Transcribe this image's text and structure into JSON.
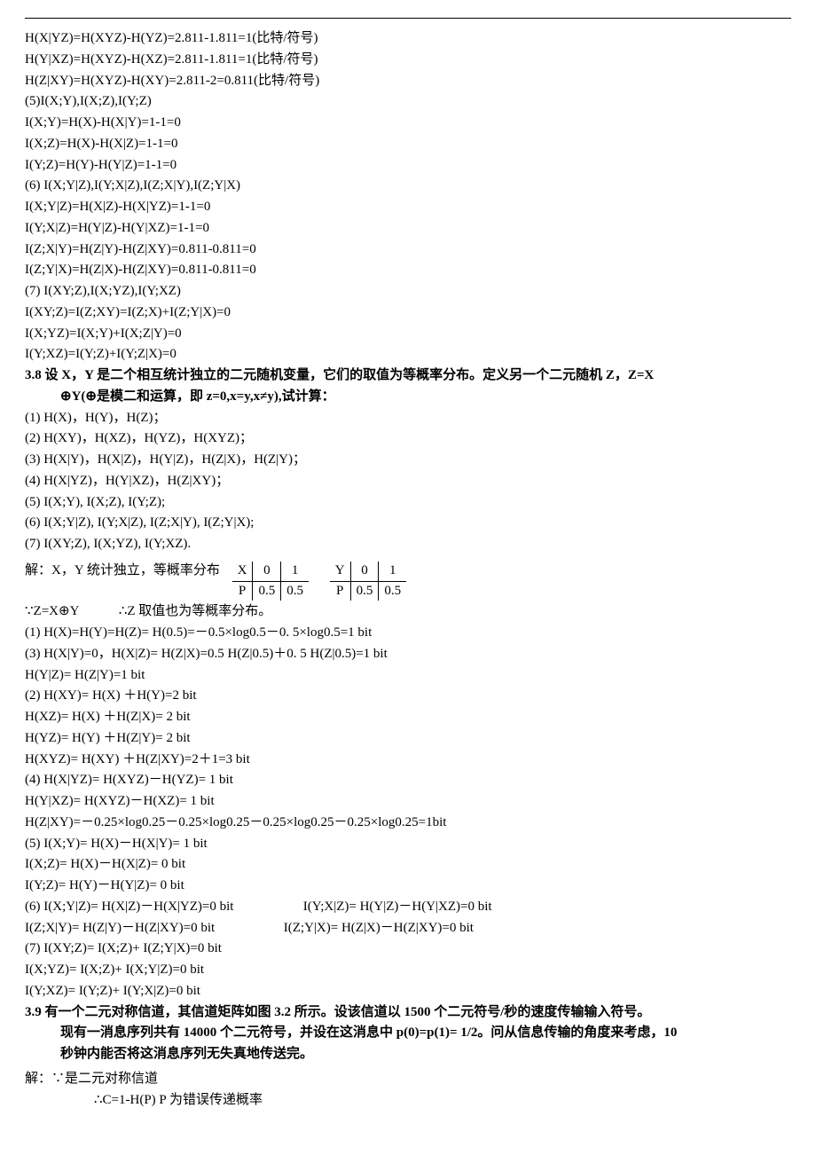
{
  "sec1": {
    "l1": "H(X|YZ)=H(XYZ)-H(YZ)=2.811-1.811=1(比特/符号)",
    "l2": "H(Y|XZ)=H(XYZ)-H(XZ)=2.811-1.811=1(比特/符号)",
    "l3": "H(Z|XY)=H(XYZ)-H(XY)=2.811-2=0.811(比特/符号)",
    "h5": "(5)I(X;Y),I(X;Z),I(Y;Z)",
    "l5a": "I(X;Y)=H(X)-H(X|Y)=1-1=0",
    "l5b": "I(X;Z)=H(X)-H(X|Z)=1-1=0",
    "l5c": "I(Y;Z)=H(Y)-H(Y|Z)=1-1=0",
    "h6": "(6) I(X;Y|Z),I(Y;X|Z),I(Z;X|Y),I(Z;Y|X)",
    "l6a": "I(X;Y|Z)=H(X|Z)-H(X|YZ)=1-1=0",
    "l6b": "I(Y;X|Z)=H(Y|Z)-H(Y|XZ)=1-1=0",
    "l6c": "I(Z;X|Y)=H(Z|Y)-H(Z|XY)=0.811-0.811=0",
    "l6d": "I(Z;Y|X)=H(Z|X)-H(Z|XY)=0.811-0.811=0",
    "h7": "(7) I(XY;Z),I(X;YZ),I(Y;XZ)",
    "l7a": "I(XY;Z)=I(Z;XY)=I(Z;X)+I(Z;Y|X)=0",
    "l7b": "I(X;YZ)=I(X;Y)+I(X;Z|Y)=0",
    "l7c": "I(Y;XZ)=I(Y;Z)+I(Y;Z|X)=0"
  },
  "p38": {
    "head1": "3.8 设 X，Y 是二个相互统计独立的二元随机变量，它们的取值为等概率分布。定义另一个二元随机 Z，Z=X",
    "head2": "⊕Y(⊕是模二和运算，即 z=0,x=y,x≠y),试计算：",
    "q1": "(1) H(X)，H(Y)，H(Z)；",
    "q2": "(2) H(XY)，H(XZ)，H(YZ)，H(XYZ)；",
    "q3": "(3) H(X|Y)，H(X|Z)，H(Y|Z)，H(Z|X)，H(Z|Y)；",
    "q4": "(4) H(X|YZ)，H(Y|XZ)，H(Z|XY)；",
    "q5": "(5) I(X;Y), I(X;Z), I(Y;Z);",
    "q6": "(6) I(X;Y|Z), I(Y;X|Z), I(Z;X|Y), I(Z;Y|X);",
    "q7": "(7) I(XY;Z), I(X;YZ), I(Y;XZ).",
    "sol_intro": "解：X，Y 统计独立，等概率分布",
    "tableX": {
      "h": "X",
      "c1": "0",
      "c2": "1",
      "p": "P",
      "v1": "0.5",
      "v2": "0.5"
    },
    "tableY": {
      "h": "Y",
      "c1": "0",
      "c2": "1",
      "p": "P",
      "v1": "0.5",
      "v2": "0.5"
    },
    "z_line": "∵Z=X⊕Y　　　∴Z 取值也为等概率分布。",
    "s1": "(1) H(X)=H(Y)=H(Z)= H(0.5)=－0.5×log0.5－0. 5×log0.5=1 bit",
    "s3a": "(3) H(X|Y)=0，H(X|Z)= H(Z|X)=0.5 H(Z|0.5)＋0. 5 H(Z|0.5)=1 bit",
    "s3b": "H(Y|Z)= H(Z|Y)=1 bit",
    "s2a": "(2) H(XY)= H(X) ＋H(Y)=2 bit",
    "s2b": "H(XZ)= H(X) ＋H(Z|X)= 2 bit",
    "s2c": "H(YZ)= H(Y) ＋H(Z|Y)= 2 bit",
    "s2d": "H(XYZ)= H(XY) ＋H(Z|XY)=2＋1=3  bit",
    "s4a": "(4) H(X|YZ)= H(XYZ)－H(YZ)= 1 bit",
    "s4b": "H(Y|XZ)= H(XYZ)－H(XZ)= 1 bit",
    "s4c": "H(Z|XY)=－0.25×log0.25－0.25×log0.25－0.25×log0.25－0.25×log0.25=1bit",
    "s5a": "(5) I(X;Y)= H(X)－H(X|Y)= 1 bit",
    "s5b": "I(X;Z)= H(X)－H(X|Z)= 0 bit",
    "s5c": "I(Y;Z)= H(Y)－H(Y|Z)= 0 bit",
    "s6a": "(6) I(X;Y|Z)= H(X|Z)－H(X|YZ)=0 bit",
    "s6b": "I(Y;X|Z)= H(Y|Z)－H(Y|XZ)=0 bit",
    "s6c": "I(Z;X|Y)= H(Z|Y)－H(Z|XY)=0 bit",
    "s6d": "I(Z;Y|X)= H(Z|X)－H(Z|XY)=0 bit",
    "s7a": "(7) I(XY;Z)= I(X;Z)+ I(Z;Y|X)=0 bit",
    "s7b": "I(X;YZ)= I(X;Z)+ I(X;Y|Z)=0 bit",
    "s7c": "I(Y;XZ)= I(Y;Z)+ I(Y;X|Z)=0 bit"
  },
  "p39": {
    "head1": "3.9 有一个二元对称信道，其信道矩阵如图 3.2 所示。设该信道以 1500 个二元符号/秒的速度传输输入符号。",
    "head2": "现有一消息序列共有 14000 个二元符号，并设在这消息中 p(0)=p(1)= 1/2。问从信息传输的角度来考虑，10",
    "head3": "秒钟内能否将这消息序列无失真地传送完。",
    "sol1": "解：∵是二元对称信道",
    "sol2": "∴C=1-H(P) P 为错误传递概率"
  }
}
